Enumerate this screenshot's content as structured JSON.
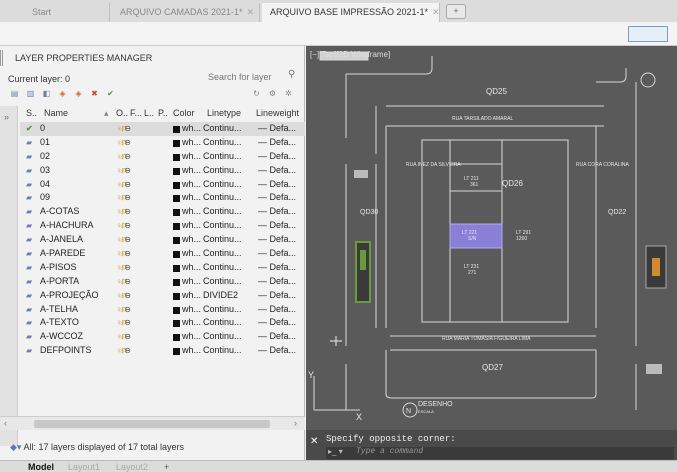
{
  "tabs": [
    {
      "label": "Start"
    },
    {
      "label": "ARQUIVO CAMADAS 2021-1*",
      "close": "✕"
    },
    {
      "label": "ARQUIVO BASE IMPRESSÃO 2021-1*",
      "close": "✕"
    }
  ],
  "tab_add": "+",
  "palette": {
    "title": "LAYER PROPERTIES MANAGER",
    "current_layer": "Current layer: 0",
    "search_placeholder": "Search for layer",
    "columns": {
      "status": "S..",
      "name": "Name",
      "on": "O..",
      "freeze": "F...",
      "lock": "L..",
      "plot": "P..",
      "color": "Color",
      "linetype": "Linetype",
      "lineweight": "Lineweight"
    },
    "layers": [
      {
        "name": "0",
        "color": "wh...",
        "linetype": "Continu...",
        "lineweight": "— Defa...",
        "current": true
      },
      {
        "name": "01",
        "color": "wh...",
        "linetype": "Continu...",
        "lineweight": "— Defa..."
      },
      {
        "name": "02",
        "color": "wh...",
        "linetype": "Continu...",
        "lineweight": "— Defa..."
      },
      {
        "name": "03",
        "color": "wh...",
        "linetype": "Continu...",
        "lineweight": "— Defa..."
      },
      {
        "name": "04",
        "color": "wh...",
        "linetype": "Continu...",
        "lineweight": "— Defa..."
      },
      {
        "name": "09",
        "color": "wh...",
        "linetype": "Continu...",
        "lineweight": "— Defa..."
      },
      {
        "name": "A-COTAS",
        "color": "wh...",
        "linetype": "Continu...",
        "lineweight": "— Defa..."
      },
      {
        "name": "A-HACHURA",
        "color": "wh...",
        "linetype": "Continu...",
        "lineweight": "— Defa..."
      },
      {
        "name": "A-JANELA",
        "color": "wh...",
        "linetype": "Continu...",
        "lineweight": "— Defa..."
      },
      {
        "name": "A-PAREDE",
        "color": "wh...",
        "linetype": "Continu...",
        "lineweight": "— Defa..."
      },
      {
        "name": "A-PISOS",
        "color": "wh...",
        "linetype": "Continu...",
        "lineweight": "— Defa..."
      },
      {
        "name": "A-PORTA",
        "color": "wh...",
        "linetype": "Continu...",
        "lineweight": "— Defa..."
      },
      {
        "name": "A-PROJEÇÃO",
        "color": "wh...",
        "linetype": "DIVIDE2",
        "lineweight": "— Defa..."
      },
      {
        "name": "A-TELHA",
        "color": "wh...",
        "linetype": "Continu...",
        "lineweight": "— Defa..."
      },
      {
        "name": "A-TEXTO",
        "color": "wh...",
        "linetype": "Continu...",
        "lineweight": "— Defa..."
      },
      {
        "name": "A-WCCOZ",
        "color": "wh...",
        "linetype": "Continu...",
        "lineweight": "— Defa..."
      },
      {
        "name": "DEFPOINTS",
        "color": "wh...",
        "linetype": "Continu...",
        "lineweight": "— Defa..."
      }
    ],
    "status": "All: 17 layers displayed of 17 total layers"
  },
  "viewport": {
    "label": "[−][Top][2D Wireframe]",
    "blocks": {
      "qd25": "QD25",
      "qd26": "QD26",
      "qd27": "QD27",
      "qd30": "QD30",
      "qd22": "QD22"
    },
    "streets": {
      "top": "RUA TARSILADO AMARAL",
      "bottom": "RUA MARIA TOMÁSIA FIGUEIRA LIMA",
      "left": "RUA INEZ DA SILVEIRA",
      "right": "RUA CORA CORALINA"
    },
    "lots": {
      "l211": "LT 211",
      "l211v": "361",
      "l221": "LT 221",
      "l221v": "S/N",
      "l291": "LT 291",
      "l291v": "1260",
      "l231": "LT 231",
      "l231v": "271"
    },
    "stamp": {
      "n": "N",
      "title": "DESENHO",
      "sub": "ESCALA"
    },
    "axis": {
      "x": "X",
      "y": "Y"
    }
  },
  "command": {
    "output": "Specify opposite corner:",
    "prompt": "▸_ ▾",
    "placeholder": "Type a command"
  },
  "layout_tabs": [
    {
      "label": "Model"
    },
    {
      "label": "Layout1"
    },
    {
      "label": "Layout2"
    }
  ],
  "layout_add": "+",
  "colors": {
    "selected_lot": "#8a7fd6",
    "highlight": "#6a9a3a"
  }
}
